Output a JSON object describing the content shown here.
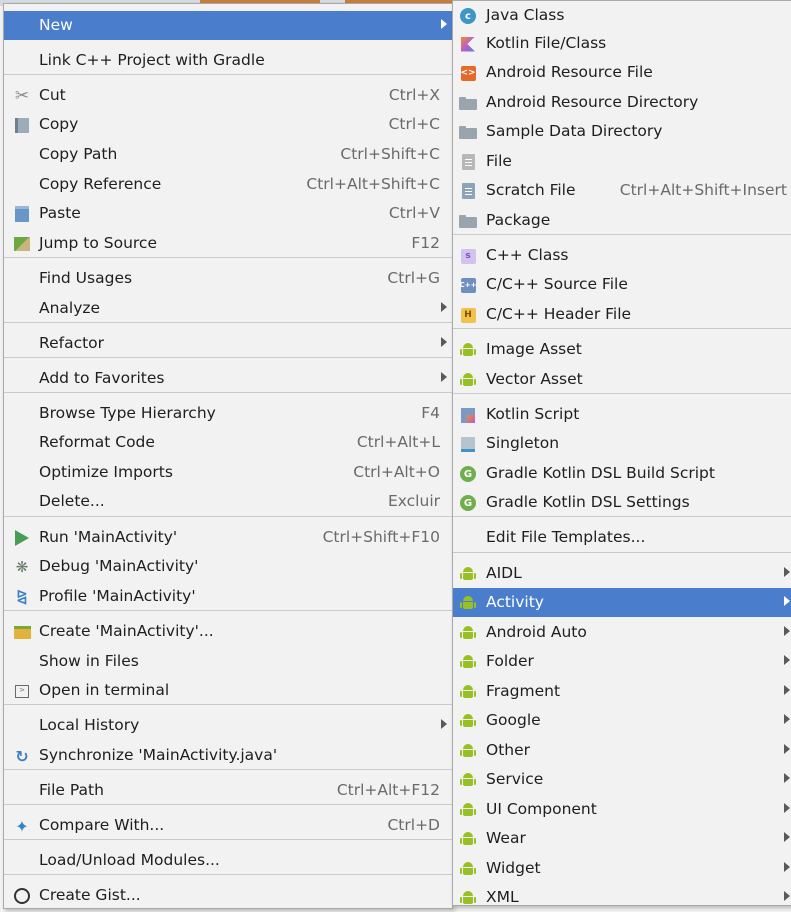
{
  "colors": {
    "selection": "#4a7dcb",
    "android_green": "#97c024",
    "menu_bg": "#f2f2f2"
  },
  "left_menu": [
    {
      "icon": "",
      "label": "New",
      "shortcut": "",
      "submenu": true,
      "selected": true
    },
    {
      "icon": "",
      "label": "Link C++ Project with Gradle",
      "shortcut": "",
      "submenu": false
    },
    {
      "icon": "scissors-icon",
      "label": "Cut",
      "shortcut": "Ctrl+X",
      "submenu": false
    },
    {
      "icon": "copy-icon",
      "label": "Copy",
      "shortcut": "Ctrl+C",
      "submenu": false
    },
    {
      "icon": "",
      "label": "Copy Path",
      "shortcut": "Ctrl+Shift+C",
      "submenu": false
    },
    {
      "icon": "",
      "label": "Copy Reference",
      "shortcut": "Ctrl+Alt+Shift+C",
      "submenu": false
    },
    {
      "icon": "paste-icon",
      "label": "Paste",
      "shortcut": "Ctrl+V",
      "submenu": false
    },
    {
      "icon": "jump-to-source-icon",
      "label": "Jump to Source",
      "shortcut": "F12",
      "submenu": false
    },
    {
      "icon": "",
      "label": "Find Usages",
      "shortcut": "Ctrl+G",
      "submenu": false
    },
    {
      "icon": "",
      "label": "Analyze",
      "shortcut": "",
      "submenu": true
    },
    {
      "icon": "",
      "label": "Refactor",
      "shortcut": "",
      "submenu": true
    },
    {
      "icon": "",
      "label": "Add to Favorites",
      "shortcut": "",
      "submenu": true
    },
    {
      "icon": "",
      "label": "Browse Type Hierarchy",
      "shortcut": "F4",
      "submenu": false
    },
    {
      "icon": "",
      "label": "Reformat Code",
      "shortcut": "Ctrl+Alt+L",
      "submenu": false
    },
    {
      "icon": "",
      "label": "Optimize Imports",
      "shortcut": "Ctrl+Alt+O",
      "submenu": false
    },
    {
      "icon": "",
      "label": "Delete...",
      "shortcut": "Excluir",
      "submenu": false
    },
    {
      "icon": "run-icon",
      "label": "Run 'MainActivity'",
      "shortcut": "Ctrl+Shift+F10",
      "submenu": false
    },
    {
      "icon": "debug-icon",
      "label": "Debug 'MainActivity'",
      "shortcut": "",
      "submenu": false
    },
    {
      "icon": "profile-icon",
      "label": "Profile 'MainActivity'",
      "shortcut": "",
      "submenu": false
    },
    {
      "icon": "create-config-icon",
      "label": "Create 'MainActivity'...",
      "shortcut": "",
      "submenu": false
    },
    {
      "icon": "",
      "label": "Show in Files",
      "shortcut": "",
      "submenu": false
    },
    {
      "icon": "terminal-icon",
      "label": "Open in terminal",
      "shortcut": "",
      "submenu": false
    },
    {
      "icon": "",
      "label": "Local History",
      "shortcut": "",
      "submenu": true
    },
    {
      "icon": "synchronize-icon",
      "label": "Synchronize 'MainActivity.java'",
      "shortcut": "",
      "submenu": false
    },
    {
      "icon": "",
      "label": "File Path",
      "shortcut": "Ctrl+Alt+F12",
      "submenu": false
    },
    {
      "icon": "compare-icon",
      "label": "Compare With...",
      "shortcut": "Ctrl+D",
      "submenu": false
    },
    {
      "icon": "",
      "label": "Load/Unload Modules...",
      "shortcut": "",
      "submenu": false
    },
    {
      "icon": "github-icon",
      "label": "Create Gist...",
      "shortcut": "",
      "submenu": false
    }
  ],
  "right_menu": [
    {
      "icon": "java-class-icon",
      "label": "Java Class",
      "shortcut": "",
      "submenu": false
    },
    {
      "icon": "kotlin-file-icon",
      "label": "Kotlin File/Class",
      "shortcut": "",
      "submenu": false
    },
    {
      "icon": "android-resource-file-icon",
      "label": "Android Resource File",
      "shortcut": "",
      "submenu": false
    },
    {
      "icon": "folder-icon",
      "label": "Android Resource Directory",
      "shortcut": "",
      "submenu": false
    },
    {
      "icon": "folder-icon",
      "label": "Sample Data Directory",
      "shortcut": "",
      "submenu": false
    },
    {
      "icon": "file-icon",
      "label": "File",
      "shortcut": "",
      "submenu": false
    },
    {
      "icon": "scratch-file-icon",
      "label": "Scratch File",
      "shortcut": "Ctrl+Alt+Shift+Insert",
      "submenu": false
    },
    {
      "icon": "package-icon",
      "label": "Package",
      "shortcut": "",
      "submenu": false
    },
    {
      "icon": "cpp-class-icon",
      "label": "C++ Class",
      "shortcut": "",
      "submenu": false
    },
    {
      "icon": "cpp-source-icon",
      "label": "C/C++ Source File",
      "shortcut": "",
      "submenu": false
    },
    {
      "icon": "cpp-header-icon",
      "label": "C/C++ Header File",
      "shortcut": "",
      "submenu": false
    },
    {
      "icon": "android-icon",
      "label": "Image Asset",
      "shortcut": "",
      "submenu": false
    },
    {
      "icon": "android-icon",
      "label": "Vector Asset",
      "shortcut": "",
      "submenu": false
    },
    {
      "icon": "kotlin-script-icon",
      "label": "Kotlin Script",
      "shortcut": "",
      "submenu": false
    },
    {
      "icon": "singleton-icon",
      "label": "Singleton",
      "shortcut": "",
      "submenu": false
    },
    {
      "icon": "gradle-icon",
      "label": "Gradle Kotlin DSL Build Script",
      "shortcut": "",
      "submenu": false
    },
    {
      "icon": "gradle-icon",
      "label": "Gradle Kotlin DSL Settings",
      "shortcut": "",
      "submenu": false
    },
    {
      "icon": "",
      "label": "Edit File Templates...",
      "shortcut": "",
      "submenu": false
    },
    {
      "icon": "android-icon",
      "label": "AIDL",
      "shortcut": "",
      "submenu": true
    },
    {
      "icon": "android-icon",
      "label": "Activity",
      "shortcut": "",
      "submenu": true,
      "selected": true
    },
    {
      "icon": "android-icon",
      "label": "Android Auto",
      "shortcut": "",
      "submenu": true
    },
    {
      "icon": "android-icon",
      "label": "Folder",
      "shortcut": "",
      "submenu": true
    },
    {
      "icon": "android-icon",
      "label": "Fragment",
      "shortcut": "",
      "submenu": true
    },
    {
      "icon": "android-icon",
      "label": "Google",
      "shortcut": "",
      "submenu": true
    },
    {
      "icon": "android-icon",
      "label": "Other",
      "shortcut": "",
      "submenu": true
    },
    {
      "icon": "android-icon",
      "label": "Service",
      "shortcut": "",
      "submenu": true
    },
    {
      "icon": "android-icon",
      "label": "UI Component",
      "shortcut": "",
      "submenu": true
    },
    {
      "icon": "android-icon",
      "label": "Wear",
      "shortcut": "",
      "submenu": true
    },
    {
      "icon": "android-icon",
      "label": "Widget",
      "shortcut": "",
      "submenu": true
    },
    {
      "icon": "android-icon",
      "label": "XML",
      "shortcut": "",
      "submenu": true
    }
  ]
}
